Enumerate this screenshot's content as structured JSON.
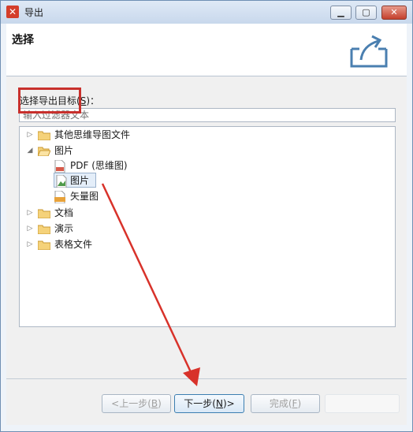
{
  "window": {
    "title": "导出"
  },
  "header": {
    "title": "选择"
  },
  "target": {
    "label": "选择导出目标(",
    "mnemonic": "S",
    "label_end": ")："
  },
  "filter": {
    "placeholder": "输入过滤器文本"
  },
  "tree": {
    "items": [
      {
        "label": "其他思维导图文件",
        "expanded": false
      },
      {
        "label": "图片",
        "expanded": true
      },
      {
        "label": "PDF (思维图)"
      },
      {
        "label": "图片",
        "selected": true
      },
      {
        "label": "矢量图"
      },
      {
        "label": "文档",
        "expanded": false
      },
      {
        "label": "演示",
        "expanded": false
      },
      {
        "label": "表格文件",
        "expanded": false
      }
    ]
  },
  "buttons": {
    "back": {
      "label": "<上一步(",
      "mnemonic": "B",
      "label_end": ")"
    },
    "next": {
      "label": "下一步(",
      "mnemonic": "N",
      "label_end": ")>"
    },
    "finish": {
      "label": "完成(",
      "mnemonic": "F",
      "label_end": ")"
    }
  },
  "colors": {
    "annotation": "#c8302c",
    "folder": "#e8b84a"
  }
}
